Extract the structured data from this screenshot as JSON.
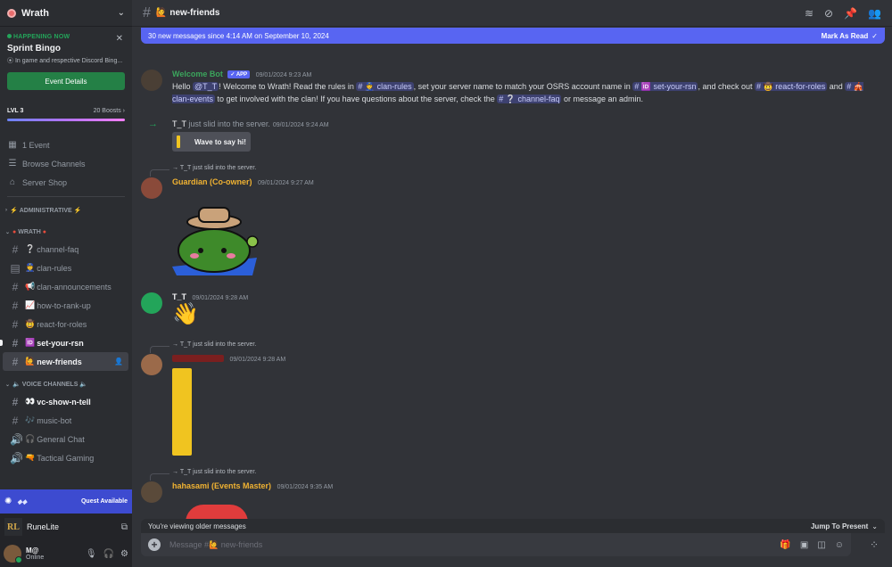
{
  "server": {
    "name": "Wrath"
  },
  "event": {
    "status": "HAPPENING NOW",
    "title": "Sprint Bingo",
    "location": "In game and respective Discord Bing...",
    "button": "Event Details"
  },
  "boost": {
    "level": "LVL 3",
    "count": "20 Boosts"
  },
  "side_links": [
    {
      "label": "1 Event"
    },
    {
      "label": "Browse Channels"
    },
    {
      "label": "Server Shop"
    }
  ],
  "categories": {
    "administrative": "ADMINISTRATIVE",
    "wrath": "WRATH",
    "voice": "VOICE CHANNELS"
  },
  "channels": [
    {
      "label": "channel-faq",
      "emoji": "❔"
    },
    {
      "label": "clan-rules",
      "emoji": "👮"
    },
    {
      "label": "clan-announcements",
      "emoji": "📢"
    },
    {
      "label": "how-to-rank-up",
      "emoji": "📈"
    },
    {
      "label": "react-for-roles",
      "emoji": "🤠"
    },
    {
      "label": "set-your-rsn",
      "emoji": "🆔"
    },
    {
      "label": "new-friends",
      "emoji": "🙋"
    }
  ],
  "voice_channels": [
    {
      "label": "vc-show-n-tell",
      "emoji": "👀"
    },
    {
      "label": "music-bot",
      "emoji": "🎶"
    },
    {
      "label": "General Chat",
      "emoji": "🎧"
    },
    {
      "label": "Tactical Gaming",
      "emoji": "🔫"
    }
  ],
  "quest": {
    "label": "Quest Available"
  },
  "activity": {
    "name": "RuneLite"
  },
  "user": {
    "name": "M@",
    "status": "Online"
  },
  "header": {
    "channel": "new-friends",
    "emoji": "🙋"
  },
  "banner": {
    "text": "30 new messages since 4:14 AM on September 10, 2024",
    "action": "Mark As Read"
  },
  "messages": {
    "bot": {
      "author": "Welcome Bot",
      "badge": "✓ APP",
      "time": "09/01/2024 9:23 AM",
      "t1": "Hello ",
      "mention_user": "@T_T",
      "t2": "! Welcome to Wrath! Read the rules in ",
      "ch1": "# 👮 clan-rules",
      "t3": ", set your server name to match your OSRS account name in ",
      "ch2": "# 🆔 set-your-rsn",
      "t4": ", and check out ",
      "ch3": "# 🤠 react-for-roles",
      "t5": " and ",
      "ch4": "# 🎪 clan-events",
      "t6": " to get involved with the clan! If you have questions about the server, check the ",
      "ch5": "# ❔ channel-faq",
      "t7": " or message an admin."
    },
    "join1": {
      "who": "T_T",
      "text": " just slid into the server.",
      "time": "09/01/2024 9:24 AM",
      "button": "Wave to say hi!"
    },
    "guardian": {
      "reply": "→ T_T just slid into the server.",
      "author": "Guardian (Co-owner)",
      "time": "09/01/2024 9:27 AM"
    },
    "tt": {
      "author": "T_T",
      "time": "09/01/2024 9:28 AM",
      "emoji": "👋"
    },
    "red_user": {
      "reply": "→ T_T just slid into the server.",
      "time": "09/01/2024 9:28 AM"
    },
    "hahasami": {
      "reply": "→ T_T just slid into the server.",
      "author": "hahasami (Events Master)",
      "time": "09/01/2024 9:35 AM"
    }
  },
  "older": {
    "text": "You're viewing older messages",
    "jump": "Jump To Present"
  },
  "composer": {
    "placeholder": "Message #🙋 new-friends"
  },
  "colors": {
    "accent": "#5865f2",
    "green": "#23a55a",
    "guardian_name": "#f0b232",
    "hahasami_name": "#f0b232",
    "bot_name": "#3ba55c"
  }
}
